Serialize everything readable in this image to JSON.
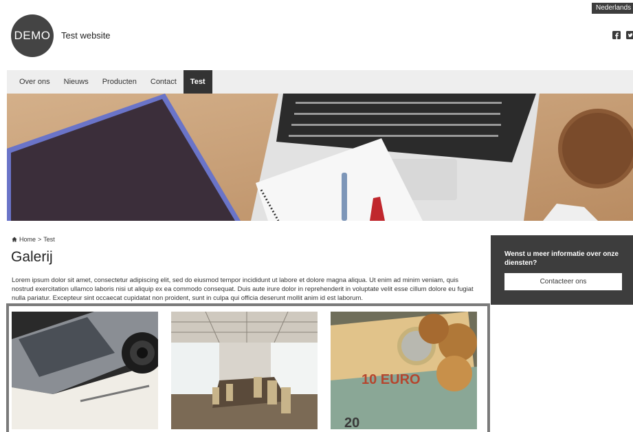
{
  "language": "Nederlands",
  "header": {
    "logo_text": "DEMO",
    "site_title": "Test website",
    "social_icons": [
      "facebook-icon",
      "twitter-icon"
    ]
  },
  "nav": {
    "items": [
      {
        "label": "Over ons"
      },
      {
        "label": "Nieuws"
      },
      {
        "label": "Producten"
      },
      {
        "label": "Contact"
      },
      {
        "label": "Test",
        "active": true
      }
    ]
  },
  "breadcrumb": {
    "home": "Home",
    "separator": ">",
    "current": "Test"
  },
  "main": {
    "title": "Galerij",
    "intro": "Lorem ipsum dolor sit amet, consectetur adipiscing elit, sed do eiusmod tempor incididunt ut labore et dolore magna aliqua. Ut enim ad minim veniam, quis nostrud exercitation ullamco laboris nisi ut aliquip ex ea commodo consequat. Duis aute irure dolor in reprehenderit in voluptate velit esse cillum dolore eu fugiat nulla pariatur. Excepteur sint occaecat cupidatat non proident, sunt in culpa qui officia deserunt mollit anim id est laborum."
  },
  "sidebar": {
    "cta_text": "Wenst u meer informatie over onze diensten?",
    "cta_button": "Contacteer ons"
  },
  "colors": {
    "dark": "#3d3d3d",
    "nav_bg": "#eeeeee",
    "gallery_border": "#7a7a7a"
  }
}
